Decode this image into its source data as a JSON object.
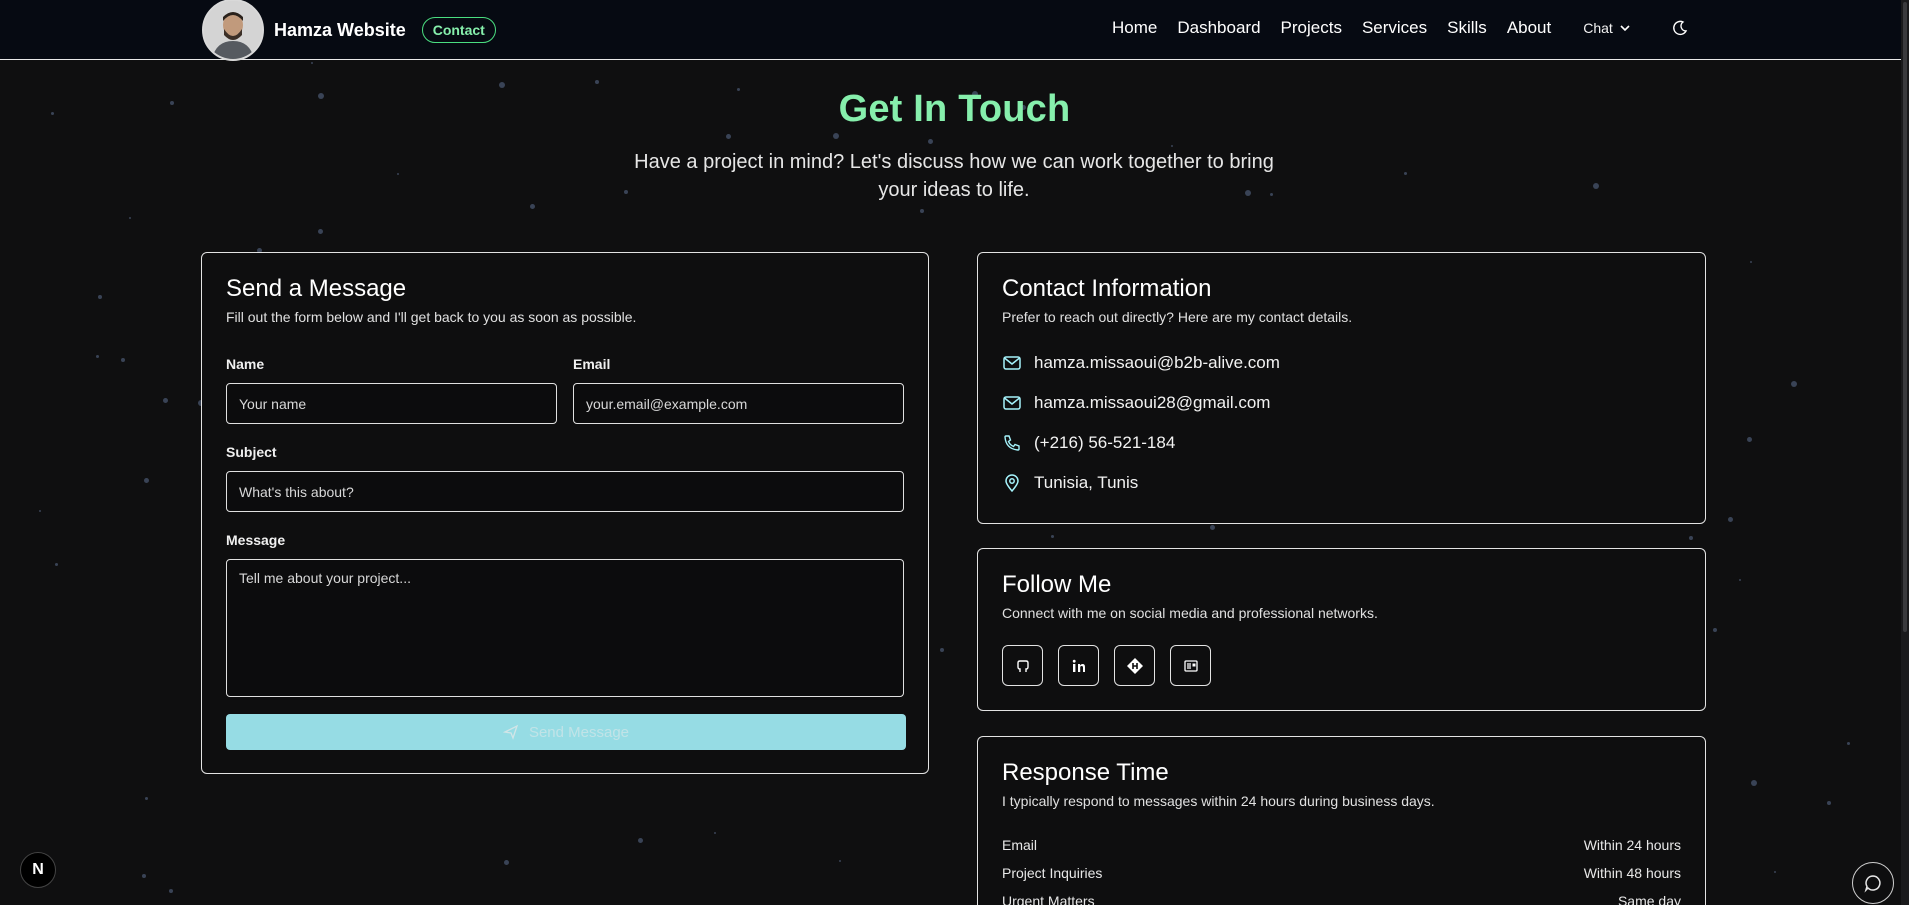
{
  "header": {
    "brand_name": "Hamza Website",
    "badge": "Contact",
    "nav": [
      "Home",
      "Dashboard",
      "Projects",
      "Services",
      "Skills",
      "About"
    ],
    "chat_label": "Chat",
    "theme_icon": "moon-icon"
  },
  "hero": {
    "title": "Get In Touch",
    "subtitle": "Have a project in mind? Let's discuss how we can work together to bring your ideas to life."
  },
  "form": {
    "title": "Send a Message",
    "description": "Fill out the form below and I'll get back to you as soon as possible.",
    "name_label": "Name",
    "name_placeholder": "Your name",
    "email_label": "Email",
    "email_placeholder": "your.email@example.com",
    "subject_label": "Subject",
    "subject_placeholder": "What's this about?",
    "message_label": "Message",
    "message_placeholder": "Tell me about your project...",
    "submit_label": "Send Message",
    "submit_icon": "send-icon"
  },
  "contact_info": {
    "title": "Contact Information",
    "description": "Prefer to reach out directly? Here are my contact details.",
    "items": [
      {
        "icon": "mail-icon",
        "text": "hamza.missaoui@b2b-alive.com"
      },
      {
        "icon": "mail-icon",
        "text": "hamza.missaoui28@gmail.com"
      },
      {
        "icon": "phone-icon",
        "text": "(+216) 56-521-184"
      },
      {
        "icon": "map-pin-icon",
        "text": "Tunisia, Tunis"
      }
    ]
  },
  "follow": {
    "title": "Follow Me",
    "description": "Connect with me on social media and professional networks.",
    "icons": [
      "github-icon",
      "linkedin-icon",
      "hashnode-icon",
      "blog-icon"
    ]
  },
  "response": {
    "title": "Response Time",
    "description": "I typically respond to messages within 24 hours during business days.",
    "rows": [
      {
        "label": "Email",
        "value": "Within 24 hours"
      },
      {
        "label": "Project Inquiries",
        "value": "Within 48 hours"
      },
      {
        "label": "Urgent Matters",
        "value": "Same day"
      }
    ]
  },
  "misc": {
    "next_badge": "N",
    "accent_green": "#86efac",
    "button_cyan": "#a5f3fc"
  }
}
